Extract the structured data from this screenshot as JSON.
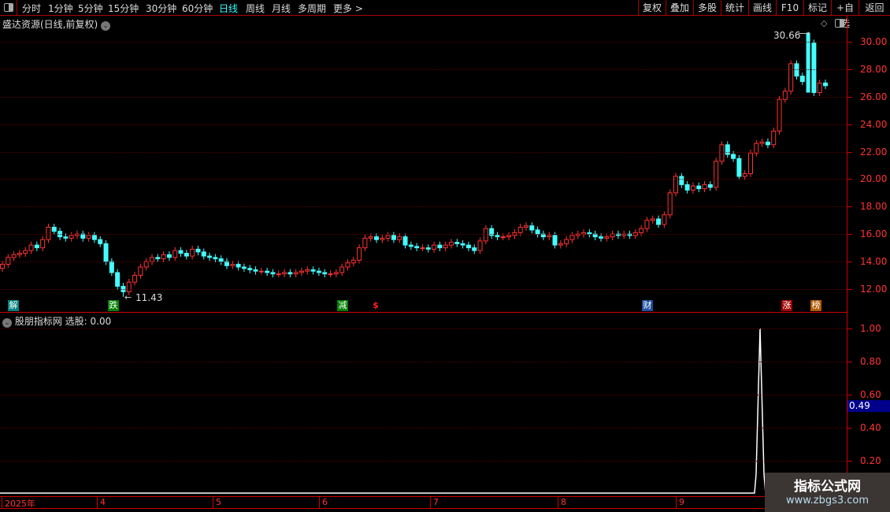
{
  "toolbar": {
    "tabs": [
      {
        "label": "分时",
        "x": 28
      },
      {
        "label": "1分钟",
        "x": 61
      },
      {
        "label": "5分钟",
        "x": 99
      },
      {
        "label": "15分钟",
        "x": 137
      },
      {
        "label": "30分钟",
        "x": 185
      },
      {
        "label": "60分钟",
        "x": 231
      },
      {
        "label": "日线",
        "x": 278,
        "active": true
      },
      {
        "label": "周线",
        "x": 312
      },
      {
        "label": "月线",
        "x": 345
      },
      {
        "label": "多周期",
        "x": 378
      },
      {
        "label": "更多 >",
        "x": 423
      }
    ],
    "right_buttons": [
      "复权",
      "叠加",
      "多股",
      "统计",
      "画线",
      "F10",
      "标记",
      "+自选",
      "返回"
    ]
  },
  "main": {
    "title": "盛达资源(日线,前复权)",
    "high_label": "30.66",
    "low_label": "11.43",
    "price_ticks": [
      "30.00",
      "28.00",
      "26.00",
      "24.00",
      "22.00",
      "20.00",
      "18.00",
      "16.00",
      "14.00",
      "12.00"
    ],
    "markers": [
      {
        "text": "解",
        "color": "#008080"
      },
      {
        "text": "跌",
        "color": "#008000"
      },
      {
        "text": "减",
        "color": "#008000"
      },
      {
        "text": "$",
        "color": "#000000"
      },
      {
        "text": "财",
        "color": "#1e4fa0"
      },
      {
        "text": "涨",
        "color": "#a00000"
      },
      {
        "text": "榜",
        "color": "#b05a00"
      }
    ]
  },
  "indicator": {
    "title": "股朋指标网",
    "value_label": "选股: 0.00",
    "ticks": [
      "1.00",
      "0.80",
      "0.60",
      "0.40",
      "0.20"
    ],
    "cursor_value": "0.49"
  },
  "time_axis": [
    "2025年",
    "4",
    "5",
    "6",
    "7",
    "8",
    "9"
  ],
  "watermark": {
    "title": "指标公式网",
    "url": "www.zbgs3.com"
  },
  "colors": {
    "up": "#ff3333",
    "down": "#44ffff",
    "axis": "#cc0000",
    "highlight": "#00ffff"
  },
  "chart_data": {
    "type": "candlestick",
    "ylim": [
      11,
      31
    ],
    "closes": [
      13.8,
      14.3,
      14.5,
      14.6,
      14.8,
      15.2,
      15.0,
      15.6,
      16.5,
      16.2,
      15.8,
      15.7,
      15.9,
      16.0,
      15.7,
      15.9,
      15.6,
      15.3,
      14.0,
      13.2,
      12.2,
      11.8,
      12.5,
      13.0,
      13.6,
      14.0,
      14.3,
      14.2,
      14.5,
      14.3,
      14.8,
      14.6,
      14.4,
      14.9,
      14.7,
      14.4,
      14.3,
      14.2,
      14.0,
      13.7,
      13.8,
      13.6,
      13.5,
      13.4,
      13.3,
      13.3,
      13.2,
      13.1,
      13.1,
      13.2,
      13.1,
      13.2,
      13.3,
      13.4,
      13.3,
      13.2,
      13.1,
      13.1,
      13.2,
      13.6,
      13.9,
      14.1,
      15.0,
      15.7,
      15.8,
      15.6,
      15.7,
      15.9,
      15.6,
      15.8,
      15.2,
      15.1,
      15.0,
      15.0,
      14.9,
      15.2,
      15.0,
      15.2,
      15.4,
      15.3,
      15.2,
      15.0,
      14.8,
      15.5,
      16.4,
      15.9,
      15.8,
      15.8,
      15.9,
      16.1,
      16.5,
      16.6,
      16.3,
      16.0,
      15.8,
      15.9,
      15.2,
      15.3,
      15.6,
      15.9,
      16.0,
      16.1,
      16.0,
      15.8,
      15.7,
      15.8,
      16.0,
      15.9,
      16.0,
      15.9,
      16.1,
      16.4,
      17.0,
      17.1,
      16.7,
      17.4,
      19.0,
      20.2,
      19.6,
      19.2,
      19.5,
      19.3,
      19.6,
      19.4,
      21.3,
      22.5,
      21.8,
      21.5,
      20.2,
      20.4,
      21.9,
      22.6,
      22.7,
      22.5,
      23.5,
      25.8,
      26.4,
      28.4,
      27.5,
      27.1,
      29.9,
      26.3,
      27.0,
      26.8
    ],
    "high": 30.66,
    "low": 11.43,
    "indicator_values_note_peak": 1.0
  }
}
